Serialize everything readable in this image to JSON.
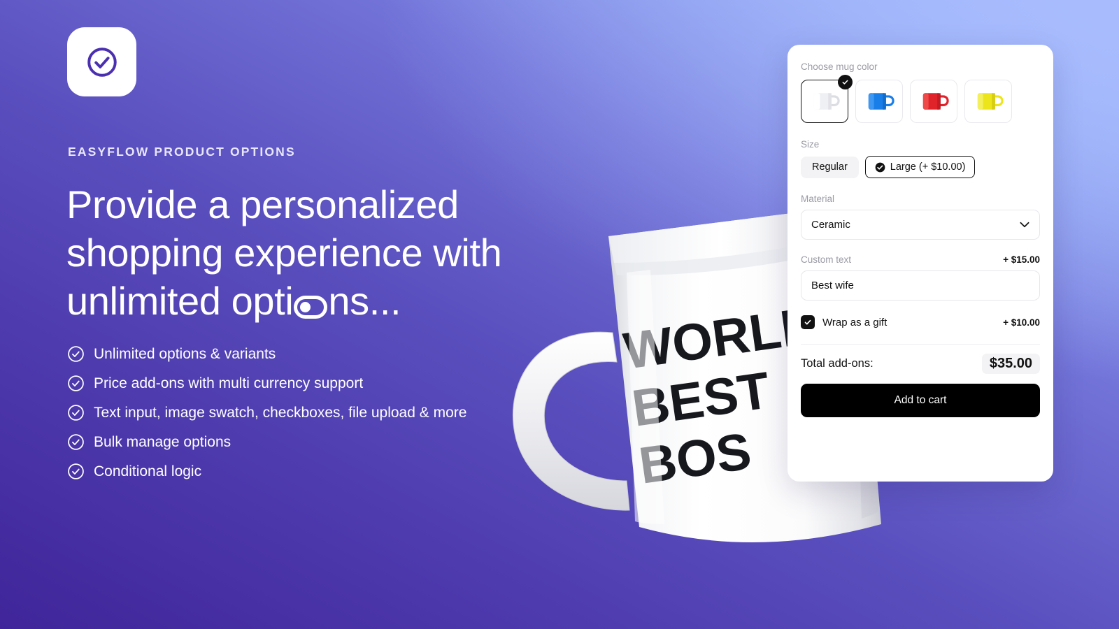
{
  "brand": {
    "logo_icon": "check-circle-icon",
    "eyebrow": "EASYFLOW PRODUCT OPTIONS",
    "headline_part1": "Provide a personalized shopping experience with unlimited opti",
    "headline_part2": "ns...",
    "toggle_glyph": "toggle-switch-icon"
  },
  "features": [
    {
      "icon": "check-circle-icon",
      "label": "Unlimited options & variants"
    },
    {
      "icon": "check-circle-icon",
      "label": "Price add-ons with multi currency support"
    },
    {
      "icon": "check-circle-icon",
      "label": "Text input, image swatch, checkboxes, file upload & more"
    },
    {
      "icon": "check-circle-icon",
      "label": "Bulk manage options"
    },
    {
      "icon": "check-circle-icon",
      "label": "Conditional logic"
    }
  ],
  "product_image": {
    "alt": "white ceramic mug",
    "print_lines": [
      "WORLD",
      "BEST",
      "BOS"
    ]
  },
  "card": {
    "color": {
      "label": "Choose mug color",
      "swatches": [
        {
          "name": "white",
          "hex": "#f2f3f5",
          "selected": true
        },
        {
          "name": "blue",
          "hex": "#1a7ee8",
          "selected": false
        },
        {
          "name": "red",
          "hex": "#e0232b",
          "selected": false
        },
        {
          "name": "yellow",
          "hex": "#ece51c",
          "selected": false
        }
      ],
      "selected_badge_icon": "check-icon"
    },
    "size": {
      "label": "Size",
      "options": [
        {
          "label": "Regular",
          "selected": false
        },
        {
          "label": "Large (+ $10.00)",
          "selected": true,
          "icon": "check-circle-icon"
        }
      ]
    },
    "material": {
      "label": "Material",
      "value": "Ceramic",
      "chevron_icon": "chevron-down-icon"
    },
    "custom_text": {
      "label": "Custom text",
      "price": "+ $15.00",
      "value": "Best wife"
    },
    "gift": {
      "label": "Wrap as a gift",
      "price": "+ $10.00",
      "checked": true,
      "icon": "check-icon"
    },
    "total": {
      "label": "Total add-ons:",
      "value": "$35.00"
    },
    "cta": {
      "label": "Add to cart"
    }
  },
  "colors": {
    "brand_indigo": "#4a2fb0",
    "bg_from": "#3f2599",
    "bg_to": "#a5baff",
    "accent_black": "#000000"
  }
}
